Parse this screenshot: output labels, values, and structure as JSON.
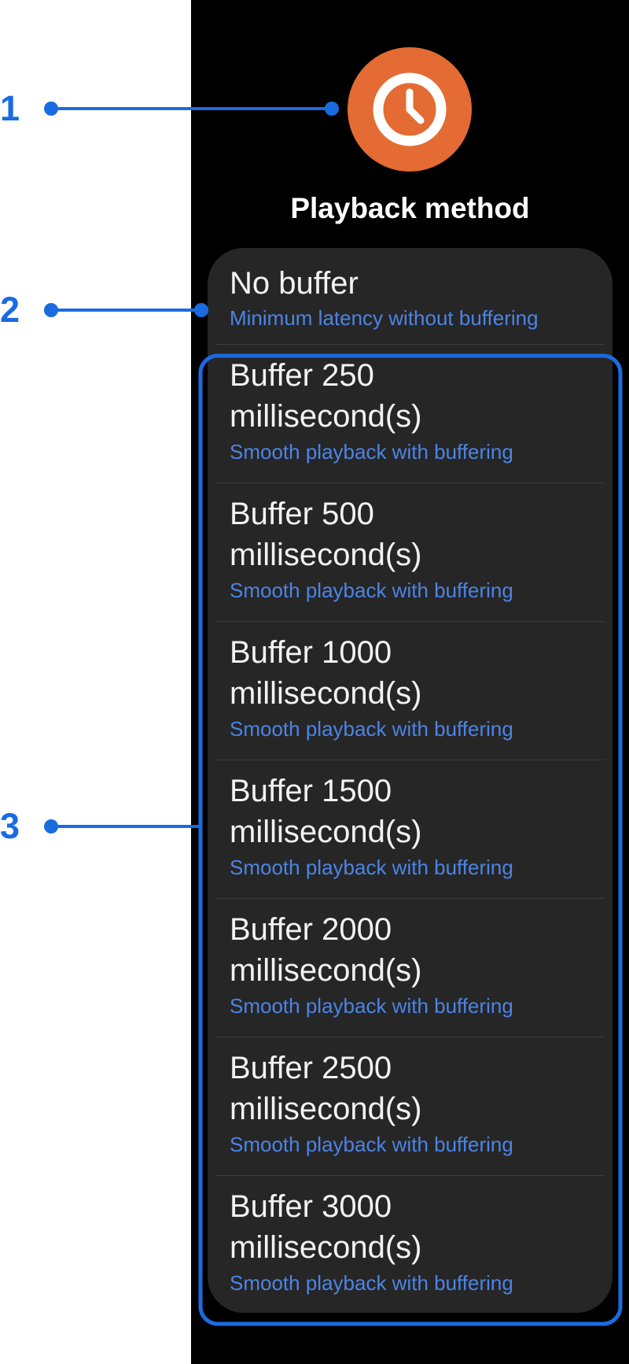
{
  "header": {
    "icon": "clock-icon",
    "title": "Playback method",
    "icon_color": "#E46B33"
  },
  "options": [
    {
      "title": "No buffer",
      "subtitle": "Minimum latency without buffering"
    },
    {
      "title": "Buffer 250 millisecond(s)",
      "subtitle": "Smooth playback with buffering"
    },
    {
      "title": "Buffer 500 millisecond(s)",
      "subtitle": "Smooth playback with buffering"
    },
    {
      "title": "Buffer 1000 millisecond(s)",
      "subtitle": "Smooth playback with buffering"
    },
    {
      "title": "Buffer 1500 millisecond(s)",
      "subtitle": "Smooth playback with buffering"
    },
    {
      "title": "Buffer 2000 millisecond(s)",
      "subtitle": "Smooth playback with buffering"
    },
    {
      "title": "Buffer 2500 millisecond(s)",
      "subtitle": "Smooth playback with buffering"
    },
    {
      "title": "Buffer 3000 millisecond(s)",
      "subtitle": "Smooth playback with buffering"
    }
  ],
  "annotations": [
    "1",
    "2",
    "3"
  ],
  "colors": {
    "accent": "#4C84E6",
    "annotation": "#1A6BE0",
    "background": "#000000",
    "card": "#262626"
  }
}
